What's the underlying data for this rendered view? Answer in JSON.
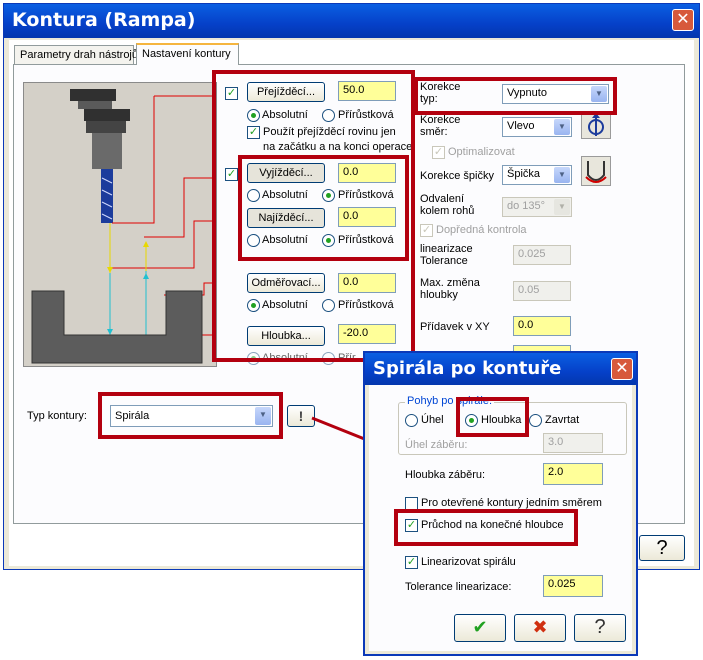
{
  "window": {
    "title": "Kontura (Rampa)"
  },
  "tabs": [
    {
      "label": "Parametry drah nástrojů"
    },
    {
      "label": "Nastavení kontury"
    }
  ],
  "approach": {
    "prejizdeci": {
      "label": "Přejížděcí...",
      "value": "50.0",
      "checked": true
    },
    "absolutni": "Absolutní",
    "prirustkova": "Přírůstková",
    "use_plane_line1": "Použít přejížděcí rovinu jen",
    "use_plane_line2": "na začátku a na konci operace",
    "vyjizdeci": {
      "label": "Vyjížděcí...",
      "value": "0.0"
    },
    "najizdeci": {
      "label": "Najížděcí...",
      "value": "0.0"
    },
    "odmerovaci": {
      "label": "Odměřovací...",
      "value": "0.0"
    },
    "hloubka": {
      "label": "Hloubka...",
      "value": "-20.0"
    },
    "absolutni_partial": "Absolutní",
    "prirustkova_partial": "Přír"
  },
  "correction": {
    "typ_label_1": "Korekce",
    "typ_label_2": "typ:",
    "typ_value": "Vypnuto",
    "smer_label_1": "Korekce",
    "smer_label_2": "směr:",
    "smer_value": "Vlevo",
    "optimalizovat": "Optimalizovat",
    "spicka_label": "Korekce špičky",
    "spicka_value": "Špička",
    "odvaleni_1": "Odvalení",
    "odvaleni_2": "kolem rohů",
    "odvaleni_value": "do 135°",
    "dopredna": "Dopředná kontrola",
    "linearizace_1": "linearizace",
    "linearizace_2": "Tolerance",
    "linearizace_value": "0.025",
    "max_zmena_1": "Max. změna",
    "max_zmena_2": "hloubky",
    "max_zmena_value": "0.05",
    "pridavek_label": "Přídavek v XY",
    "pridavek_value": "0.0"
  },
  "contour_type": {
    "label": "Typ kontury:",
    "value": "Spirála"
  },
  "help_label": "?",
  "dialog": {
    "title": "Spirála po kontuře",
    "group_caption": "Pohyb po spirále:",
    "uhel": "Úhel",
    "hloubka": "Hloubka",
    "zavrtat": "Zavrtat",
    "uhel_zaberu_label": "Úhel záběru:",
    "uhel_zaberu_value": "3.0",
    "hloubka_zaberu_label": "Hloubka záběru:",
    "hloubka_zaberu_value": "2.0",
    "otevrene": "Pro otevřené kontury jedním směrem",
    "pruchod": "Průchod na konečné hloubce",
    "linearizovat": "Linearizovat spirálu",
    "tolerance_label": "Tolerance linearizace:",
    "tolerance_value": "0.025",
    "ok_glyph": "✔",
    "cancel_glyph": "✖",
    "help_glyph": "?"
  },
  "colors": {
    "highlight": "#b3000f",
    "input_yellow": "#ffff99",
    "titlebar": "#0540c8",
    "check_green": "#21a121"
  }
}
